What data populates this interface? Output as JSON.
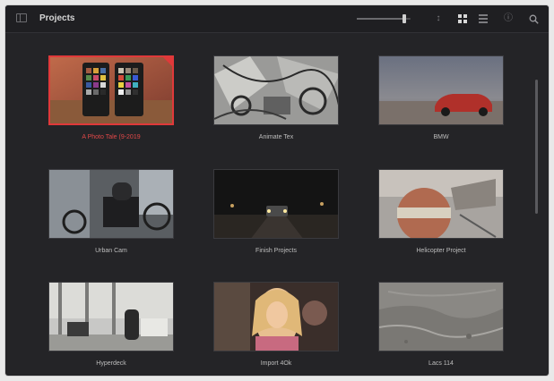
{
  "app": {
    "title": "Projects",
    "zoom_level": 0.88
  },
  "toolbar": {
    "panel_toggle_icon": "sidebar-panel-icon",
    "sort_icon": "sort-icon",
    "grid_view_icon": "grid-view-icon",
    "list_view_icon": "list-view-icon",
    "info_icon": "info-icon",
    "search_icon": "search-icon",
    "sort_glyph": "↕",
    "info_glyph": "ⓘ"
  },
  "projects": [
    {
      "name": "A Photo Tale (9-2019",
      "selected": true
    },
    {
      "name": "Animate Tex",
      "selected": false
    },
    {
      "name": "BMW",
      "selected": false
    },
    {
      "name": "Urban Cam",
      "selected": false
    },
    {
      "name": "Finish Projects",
      "selected": false
    },
    {
      "name": "Helicopter Project",
      "selected": false
    },
    {
      "name": "Hyperdeck",
      "selected": false
    },
    {
      "name": "Import 4Ok",
      "selected": false
    },
    {
      "name": "Lacs 114",
      "selected": false
    }
  ],
  "colors": {
    "window_bg": "#242427",
    "selection_accent": "#e0393a",
    "label_text": "#bdbdbd"
  }
}
